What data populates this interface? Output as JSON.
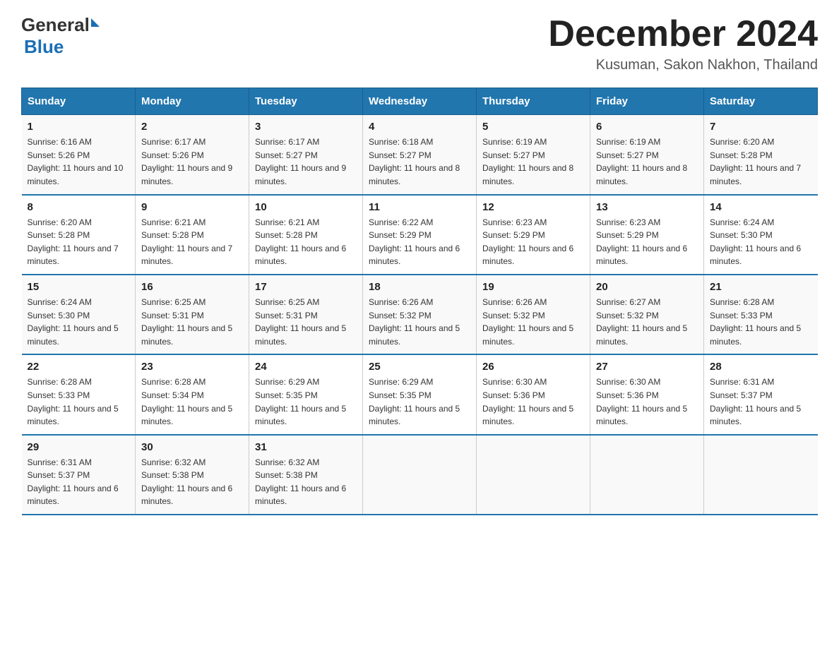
{
  "header": {
    "logo": {
      "general": "General",
      "blue": "Blue"
    },
    "title": "December 2024",
    "location": "Kusuman, Sakon Nakhon, Thailand"
  },
  "weekdays": [
    "Sunday",
    "Monday",
    "Tuesday",
    "Wednesday",
    "Thursday",
    "Friday",
    "Saturday"
  ],
  "weeks": [
    [
      {
        "day": "1",
        "sunrise": "6:16 AM",
        "sunset": "5:26 PM",
        "daylight": "11 hours and 10 minutes."
      },
      {
        "day": "2",
        "sunrise": "6:17 AM",
        "sunset": "5:26 PM",
        "daylight": "11 hours and 9 minutes."
      },
      {
        "day": "3",
        "sunrise": "6:17 AM",
        "sunset": "5:27 PM",
        "daylight": "11 hours and 9 minutes."
      },
      {
        "day": "4",
        "sunrise": "6:18 AM",
        "sunset": "5:27 PM",
        "daylight": "11 hours and 8 minutes."
      },
      {
        "day": "5",
        "sunrise": "6:19 AM",
        "sunset": "5:27 PM",
        "daylight": "11 hours and 8 minutes."
      },
      {
        "day": "6",
        "sunrise": "6:19 AM",
        "sunset": "5:27 PM",
        "daylight": "11 hours and 8 minutes."
      },
      {
        "day": "7",
        "sunrise": "6:20 AM",
        "sunset": "5:28 PM",
        "daylight": "11 hours and 7 minutes."
      }
    ],
    [
      {
        "day": "8",
        "sunrise": "6:20 AM",
        "sunset": "5:28 PM",
        "daylight": "11 hours and 7 minutes."
      },
      {
        "day": "9",
        "sunrise": "6:21 AM",
        "sunset": "5:28 PM",
        "daylight": "11 hours and 7 minutes."
      },
      {
        "day": "10",
        "sunrise": "6:21 AM",
        "sunset": "5:28 PM",
        "daylight": "11 hours and 6 minutes."
      },
      {
        "day": "11",
        "sunrise": "6:22 AM",
        "sunset": "5:29 PM",
        "daylight": "11 hours and 6 minutes."
      },
      {
        "day": "12",
        "sunrise": "6:23 AM",
        "sunset": "5:29 PM",
        "daylight": "11 hours and 6 minutes."
      },
      {
        "day": "13",
        "sunrise": "6:23 AM",
        "sunset": "5:29 PM",
        "daylight": "11 hours and 6 minutes."
      },
      {
        "day": "14",
        "sunrise": "6:24 AM",
        "sunset": "5:30 PM",
        "daylight": "11 hours and 6 minutes."
      }
    ],
    [
      {
        "day": "15",
        "sunrise": "6:24 AM",
        "sunset": "5:30 PM",
        "daylight": "11 hours and 5 minutes."
      },
      {
        "day": "16",
        "sunrise": "6:25 AM",
        "sunset": "5:31 PM",
        "daylight": "11 hours and 5 minutes."
      },
      {
        "day": "17",
        "sunrise": "6:25 AM",
        "sunset": "5:31 PM",
        "daylight": "11 hours and 5 minutes."
      },
      {
        "day": "18",
        "sunrise": "6:26 AM",
        "sunset": "5:32 PM",
        "daylight": "11 hours and 5 minutes."
      },
      {
        "day": "19",
        "sunrise": "6:26 AM",
        "sunset": "5:32 PM",
        "daylight": "11 hours and 5 minutes."
      },
      {
        "day": "20",
        "sunrise": "6:27 AM",
        "sunset": "5:32 PM",
        "daylight": "11 hours and 5 minutes."
      },
      {
        "day": "21",
        "sunrise": "6:28 AM",
        "sunset": "5:33 PM",
        "daylight": "11 hours and 5 minutes."
      }
    ],
    [
      {
        "day": "22",
        "sunrise": "6:28 AM",
        "sunset": "5:33 PM",
        "daylight": "11 hours and 5 minutes."
      },
      {
        "day": "23",
        "sunrise": "6:28 AM",
        "sunset": "5:34 PM",
        "daylight": "11 hours and 5 minutes."
      },
      {
        "day": "24",
        "sunrise": "6:29 AM",
        "sunset": "5:35 PM",
        "daylight": "11 hours and 5 minutes."
      },
      {
        "day": "25",
        "sunrise": "6:29 AM",
        "sunset": "5:35 PM",
        "daylight": "11 hours and 5 minutes."
      },
      {
        "day": "26",
        "sunrise": "6:30 AM",
        "sunset": "5:36 PM",
        "daylight": "11 hours and 5 minutes."
      },
      {
        "day": "27",
        "sunrise": "6:30 AM",
        "sunset": "5:36 PM",
        "daylight": "11 hours and 5 minutes."
      },
      {
        "day": "28",
        "sunrise": "6:31 AM",
        "sunset": "5:37 PM",
        "daylight": "11 hours and 5 minutes."
      }
    ],
    [
      {
        "day": "29",
        "sunrise": "6:31 AM",
        "sunset": "5:37 PM",
        "daylight": "11 hours and 6 minutes."
      },
      {
        "day": "30",
        "sunrise": "6:32 AM",
        "sunset": "5:38 PM",
        "daylight": "11 hours and 6 minutes."
      },
      {
        "day": "31",
        "sunrise": "6:32 AM",
        "sunset": "5:38 PM",
        "daylight": "11 hours and 6 minutes."
      },
      null,
      null,
      null,
      null
    ]
  ]
}
